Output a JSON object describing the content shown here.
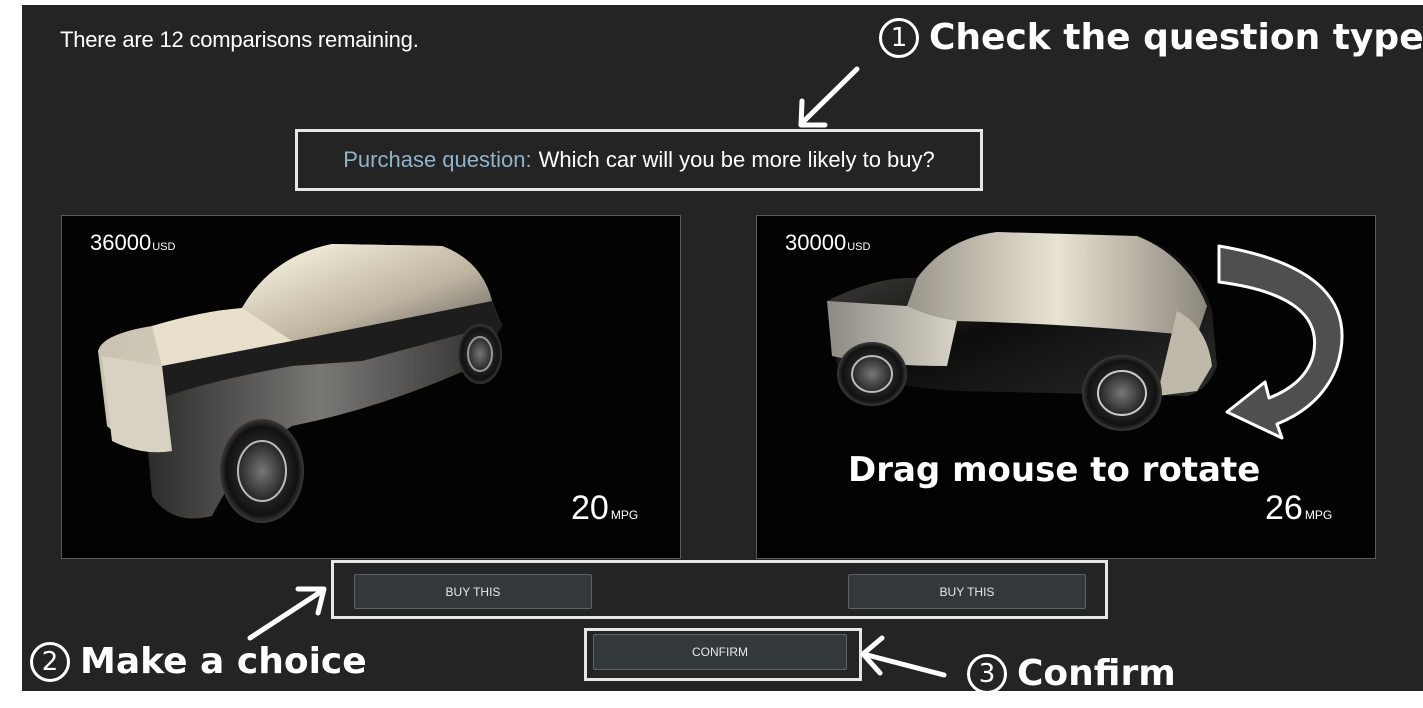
{
  "status": {
    "remaining_text": "There are 12 comparisons remaining."
  },
  "question": {
    "type_label": "Purchase question:",
    "text": "Which car will you be more likely to buy?"
  },
  "cars": [
    {
      "price": "36000",
      "price_unit": "USD",
      "mpg": "20",
      "mpg_unit": "MPG",
      "button_label": "BUY THIS"
    },
    {
      "price": "30000",
      "price_unit": "USD",
      "mpg": "26",
      "mpg_unit": "MPG",
      "button_label": "BUY THIS"
    }
  ],
  "confirm_label": "CONFIRM",
  "annotations": {
    "step1_num": "1",
    "step1_text": "Check the question type",
    "step2_num": "2",
    "step2_text": "Make a choice",
    "step3_num": "3",
    "step3_text": "Confirm",
    "rotate_hint": "Drag mouse to rotate"
  },
  "colors": {
    "background": "#242424",
    "viewer_bg": "#030303",
    "question_type_accent": "#8fb3c9",
    "button_bg": "#33393a",
    "annotation": "#ffffff"
  },
  "icons": [
    "arrow-icon",
    "rotate-arrow-icon"
  ]
}
